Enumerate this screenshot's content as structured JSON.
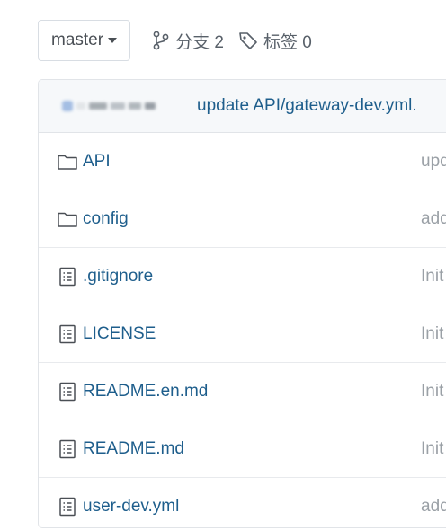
{
  "toolbar": {
    "branch": "master",
    "branches_label": "分支 2",
    "tags_label": "标签 0"
  },
  "last_commit": {
    "message": "update API/gateway-dev.yml."
  },
  "files": [
    {
      "name": "API",
      "type": "folder",
      "commit": "upd"
    },
    {
      "name": "config",
      "type": "folder",
      "commit": "add"
    },
    {
      "name": ".gitignore",
      "type": "file",
      "commit": "Init"
    },
    {
      "name": "LICENSE",
      "type": "file",
      "commit": "Init"
    },
    {
      "name": "README.en.md",
      "type": "file",
      "commit": "Init"
    },
    {
      "name": "README.md",
      "type": "file",
      "commit": "Init"
    },
    {
      "name": "user-dev.yml",
      "type": "file",
      "commit": "add"
    }
  ],
  "colors": {
    "link": "#1e5e8c",
    "muted": "#9aa0a6",
    "border": "#e1e4e8"
  }
}
